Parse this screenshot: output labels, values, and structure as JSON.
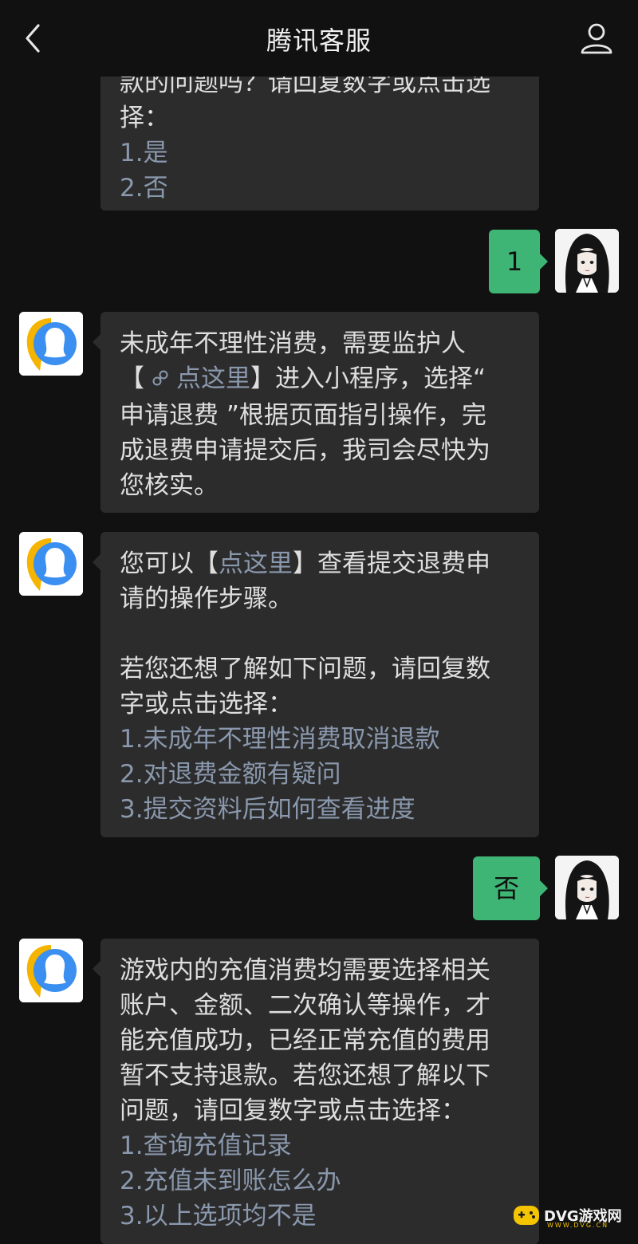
{
  "header": {
    "title": "腾讯客服"
  },
  "messages": {
    "m0": {
      "lines": [
        "款的问题吗？请回复数字或点击选",
        "择："
      ],
      "options": [
        "1.是",
        "2.否"
      ]
    },
    "m1": {
      "text": "1"
    },
    "m2": {
      "line1": "未成年不理性消费，需要监护人",
      "bracket_open": "【",
      "link_label": "点这里",
      "after_link": "】进入小程序，选择“",
      "rest": [
        "申请退费 ”根据页面指引操作，完",
        "成退费申请提交后，我司会尽快为",
        "您核实。"
      ]
    },
    "m3": {
      "prefix": "您可以【",
      "link_label": "点这里",
      "suffix": "】查看提交退费申",
      "line2": "请的操作步骤。",
      "para2": [
        "若您还想了解如下问题，请回复数",
        "字或点击选择："
      ],
      "options": [
        "1.未成年不理性消费取消退款",
        "2.对退费金额有疑问",
        "3.提交资料后如何查看进度"
      ]
    },
    "m4": {
      "text": "否"
    },
    "m5": {
      "lines": [
        "游戏内的充值消费均需要选择相关",
        "账户、金额、二次确认等操作，才",
        "能充值成功，已经正常充值的费用",
        "暂不支持退款。若您还想了解以下",
        "问题，请回复数字或点击选择："
      ],
      "options": [
        "1.查询充值记录",
        "2.充值未到账怎么办",
        "3.以上选项均不是"
      ]
    }
  },
  "watermark": {
    "text": "DVG游戏网",
    "sub": "WWW.DVG.CN"
  },
  "colors": {
    "background": "#111111",
    "bubble": "#2c2c2c",
    "user_bubble": "#3eb575",
    "option_text": "#8a98ad",
    "bot_avatar_blue": "#3b8ff0",
    "bot_avatar_yellow": "#f5b400"
  },
  "icons": {
    "back": "chevron-left-icon",
    "profile": "person-icon",
    "mini_program": "mini-program-link-icon"
  }
}
